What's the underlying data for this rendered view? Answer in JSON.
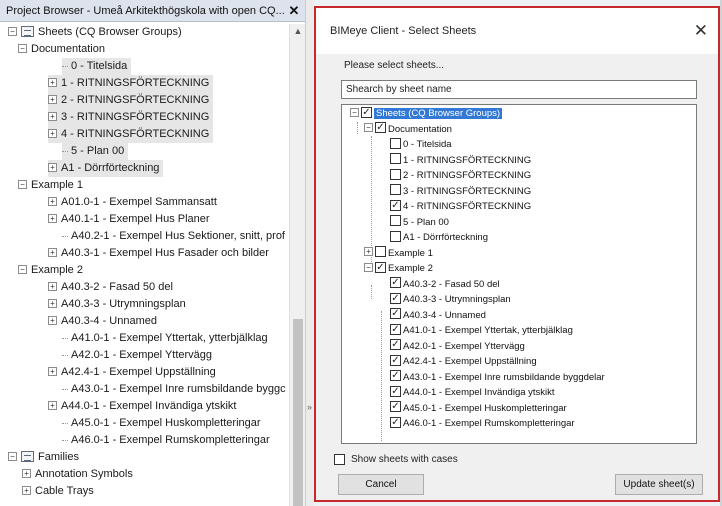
{
  "project_browser": {
    "title": "Project Browser - Umeå Arkitekthögskola with open CQ...",
    "close_glyph": "✕",
    "rows": [
      {
        "label": "Sheets (CQ Browser Groups)",
        "x": 8,
        "exp": "−",
        "icon": "folder-icon",
        "hl": false
      },
      {
        "label": "Documentation",
        "x": 18,
        "exp": "−",
        "hl": false
      },
      {
        "label": "0 - Titelsida",
        "x": 62,
        "exp": "",
        "hl": true
      },
      {
        "label": "1 - RITNINGSFÖRTECKNING",
        "x": 48,
        "exp": "+",
        "hl": true
      },
      {
        "label": "2 - RITNINGSFÖRTECKNING",
        "x": 48,
        "exp": "+",
        "hl": true
      },
      {
        "label": "3 - RITNINGSFÖRTECKNING",
        "x": 48,
        "exp": "+",
        "hl": true
      },
      {
        "label": "4 - RITNINGSFÖRTECKNING",
        "x": 48,
        "exp": "+",
        "hl": true
      },
      {
        "label": "5 - Plan 00",
        "x": 62,
        "exp": "",
        "hl": true
      },
      {
        "label": "A1 - Dörrförteckning",
        "x": 48,
        "exp": "+",
        "hl": true
      },
      {
        "label": "Example 1",
        "x": 18,
        "exp": "−",
        "hl": false
      },
      {
        "label": "A01.0-1 - Exempel Sammansatt",
        "x": 48,
        "exp": "+",
        "hl": false
      },
      {
        "label": "A40.1-1 - Exempel Hus Planer",
        "x": 48,
        "exp": "+",
        "hl": false
      },
      {
        "label": "A40.2-1 - Exempel Hus Sektioner, snitt, prof",
        "x": 62,
        "exp": "",
        "hl": false
      },
      {
        "label": "A40.3-1 - Exempel Hus Fasader och bilder",
        "x": 48,
        "exp": "+",
        "hl": false
      },
      {
        "label": "Example 2",
        "x": 18,
        "exp": "−",
        "hl": false
      },
      {
        "label": "A40.3-2 - Fasad 50 del",
        "x": 48,
        "exp": "+",
        "hl": false
      },
      {
        "label": "A40.3-3 - Utrymningsplan",
        "x": 48,
        "exp": "+",
        "hl": false
      },
      {
        "label": "A40.3-4 - Unnamed",
        "x": 48,
        "exp": "+",
        "hl": false
      },
      {
        "label": "A41.0-1 - Exempel Yttertak, ytterbjälklag",
        "x": 62,
        "exp": "",
        "hl": false
      },
      {
        "label": "A42.0-1 - Exempel Yttervägg",
        "x": 62,
        "exp": "",
        "hl": false
      },
      {
        "label": "A42.4-1 - Exempel Uppställning",
        "x": 48,
        "exp": "+",
        "hl": false
      },
      {
        "label": "A43.0-1 - Exempel Inre rumsbildande byggc",
        "x": 62,
        "exp": "",
        "hl": false
      },
      {
        "label": "A44.0-1 - Exempel Invändiga ytskikt",
        "x": 48,
        "exp": "+",
        "hl": false
      },
      {
        "label": "A45.0-1 - Exempel Huskompletteringar",
        "x": 62,
        "exp": "",
        "hl": false
      },
      {
        "label": "A46.0-1 - Exempel Rumskompletteringar",
        "x": 62,
        "exp": "",
        "hl": false
      },
      {
        "label": "Families",
        "x": 8,
        "exp": "−",
        "icon": "families-icon",
        "hl": false
      },
      {
        "label": "Annotation Symbols",
        "x": 22,
        "exp": "+",
        "hl": false
      },
      {
        "label": "Cable Trays",
        "x": 22,
        "exp": "+",
        "hl": false
      }
    ]
  },
  "dialog": {
    "title": "BIMeye Client - Select Sheets",
    "close_glyph": "✕",
    "prompt": "Please select sheets...",
    "search_value": "Shearch by sheet name",
    "tree": [
      {
        "label": "Sheets (CQ Browser Groups)",
        "x": 8,
        "exp": "−",
        "checked": true,
        "selected": true
      },
      {
        "label": "Documentation",
        "x": 22,
        "exp": "−",
        "checked": true
      },
      {
        "label": "0 - Titelsida",
        "x": 48,
        "exp": "",
        "checked": false
      },
      {
        "label": "1 - RITNINGSFÖRTECKNING",
        "x": 48,
        "exp": "",
        "checked": false
      },
      {
        "label": "2 - RITNINGSFÖRTECKNING",
        "x": 48,
        "exp": "",
        "checked": false
      },
      {
        "label": "3 - RITNINGSFÖRTECKNING",
        "x": 48,
        "exp": "",
        "checked": false
      },
      {
        "label": "4 - RITNINGSFÖRTECKNING",
        "x": 48,
        "exp": "",
        "checked": true
      },
      {
        "label": "5 - Plan 00",
        "x": 48,
        "exp": "",
        "checked": false
      },
      {
        "label": "A1 - Dörrförteckning",
        "x": 48,
        "exp": "",
        "checked": false
      },
      {
        "label": "Example 1",
        "x": 22,
        "exp": "+",
        "checked": false
      },
      {
        "label": "Example 2",
        "x": 22,
        "exp": "−",
        "checked": true
      },
      {
        "label": "A40.3-2 - Fasad 50 del",
        "x": 48,
        "exp": "",
        "checked": true
      },
      {
        "label": "A40.3-3 - Utrymningsplan",
        "x": 48,
        "exp": "",
        "checked": true
      },
      {
        "label": "A40.3-4 - Unnamed",
        "x": 48,
        "exp": "",
        "checked": true
      },
      {
        "label": "A41.0-1 - Exempel Yttertak, ytterbjälklag",
        "x": 48,
        "exp": "",
        "checked": true
      },
      {
        "label": "A42.0-1 - Exempel Yttervägg",
        "x": 48,
        "exp": "",
        "checked": true
      },
      {
        "label": "A42.4-1 - Exempel Uppställning",
        "x": 48,
        "exp": "",
        "checked": true
      },
      {
        "label": "A43.0-1 - Exempel Inre rumsbildande byggdelar",
        "x": 48,
        "exp": "",
        "checked": true
      },
      {
        "label": "A44.0-1 - Exempel Invändiga ytskikt",
        "x": 48,
        "exp": "",
        "checked": true
      },
      {
        "label": "A45.0-1 - Exempel Huskompletteringar",
        "x": 48,
        "exp": "",
        "checked": true
      },
      {
        "label": "A46.0-1 - Exempel Rumskompletteringar",
        "x": 48,
        "exp": "",
        "checked": true
      }
    ],
    "show_cases_label": "Show sheets with cases",
    "show_cases_checked": false,
    "cancel_label": "Cancel",
    "update_label": "Update sheet(s)"
  },
  "colors": {
    "dialog_border": "#c6282b",
    "selection": "#3278d6",
    "row_highlight": "#e6e6e6"
  }
}
